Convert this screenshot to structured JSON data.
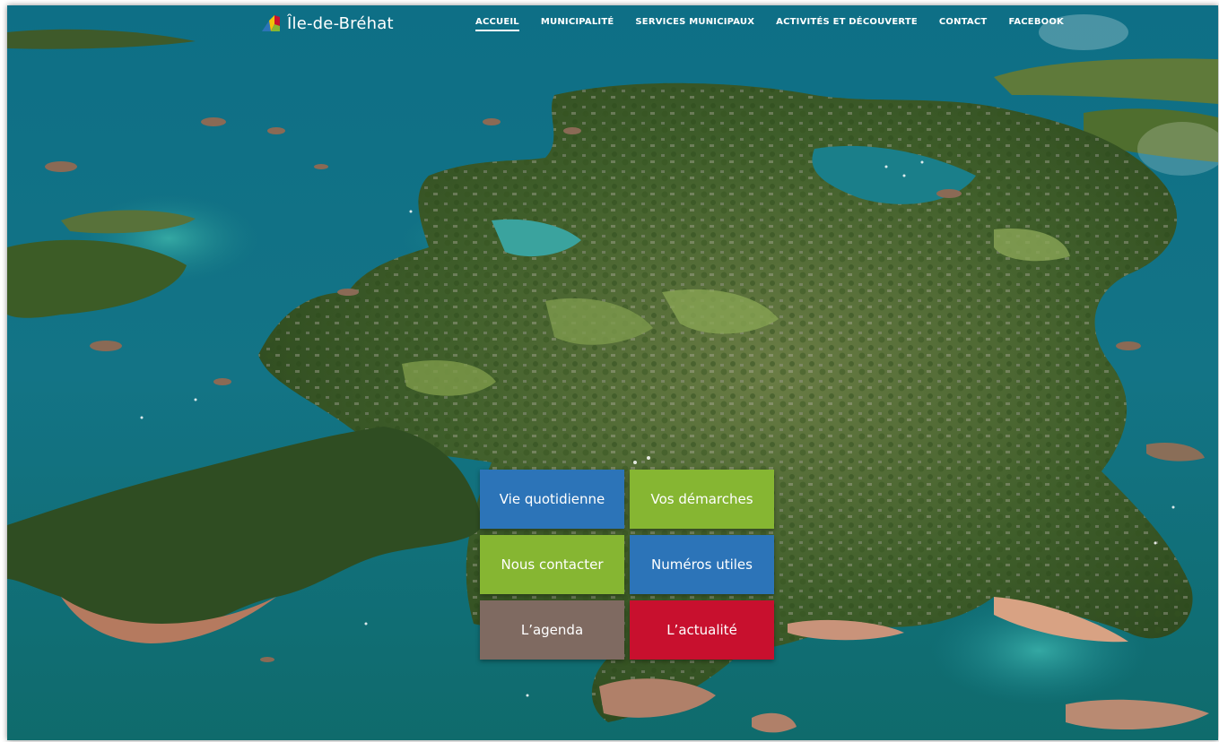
{
  "header": {
    "logo_text": "Île-de-Bréhat",
    "logo_icon": "island-flag-logo-icon"
  },
  "nav": [
    {
      "label": "ACCUEIL",
      "active": true
    },
    {
      "label": "MUNICIPALITÉ",
      "active": false
    },
    {
      "label": "SERVICES MUNICIPAUX",
      "active": false
    },
    {
      "label": "ACTIVITÉS ET DÉCOUVERTE",
      "active": false
    },
    {
      "label": "CONTACT",
      "active": false
    },
    {
      "label": "FACEBOOK",
      "active": false
    }
  ],
  "tiles": [
    {
      "label": "Vie quotidienne",
      "color": "#2c74b8"
    },
    {
      "label": "Vos démarches",
      "color": "#86b632"
    },
    {
      "label": "Nous contacter",
      "color": "#86b632"
    },
    {
      "label": "Numéros utiles",
      "color": "#2c74b8"
    },
    {
      "label": "L’agenda",
      "color": "#7f6a61"
    },
    {
      "label": "L’actualité",
      "color": "#c8102e"
    }
  ],
  "colors": {
    "sea_deep": "#0c5f6e",
    "sea_shallow": "#2a9aa0",
    "land": "#4c6b2a",
    "rock": "#c08a6e"
  }
}
